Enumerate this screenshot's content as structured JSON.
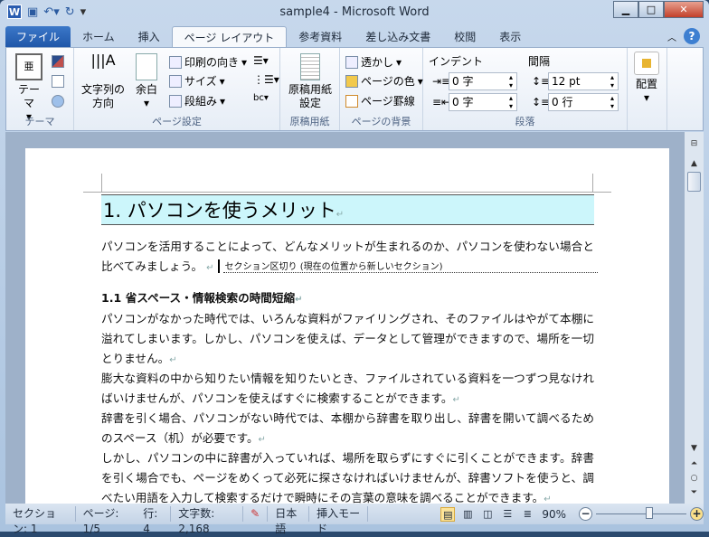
{
  "window": {
    "title": "sample4 - Microsoft Word",
    "app_icon": "W",
    "minimize": "▁",
    "maximize": "□",
    "close": "✕"
  },
  "qat": {
    "save": "save-icon",
    "undo": "undo-icon",
    "redo": "redo-icon"
  },
  "tabs": [
    {
      "label": "ファイル"
    },
    {
      "label": "ホーム"
    },
    {
      "label": "挿入"
    },
    {
      "label": "ページ レイアウト"
    },
    {
      "label": "参考資料"
    },
    {
      "label": "差し込み文書"
    },
    {
      "label": "校閲"
    },
    {
      "label": "表示"
    }
  ],
  "help": "?",
  "ribbon": {
    "theme": {
      "label": "テーマ",
      "group": "テーマ"
    },
    "page_setup": {
      "group": "ページ設定",
      "direction": "文字列の方向",
      "margins": "余白",
      "orientation": "印刷の向き",
      "size": "サイズ",
      "columns": "段組み"
    },
    "genko": {
      "group": "原稿用紙",
      "button": "原稿用紙設定"
    },
    "background": {
      "group": "ページの背景",
      "watermark": "透かし",
      "color": "ページの色",
      "borders": "ページ罫線"
    },
    "paragraph": {
      "group": "段落",
      "indent": "インデント",
      "spacing": "間隔",
      "indent_left": "0 字",
      "indent_right": "0 字",
      "space_before": "12 pt",
      "space_after": "0 行"
    },
    "arrange": {
      "label": "配置"
    }
  },
  "document": {
    "heading1": "1. パソコンを使うメリット",
    "intro": [
      "パソコンを活用することによって、どんなメリットが生まれるのか、パソコンを使わない場合と",
      "比べてみましょう。"
    ],
    "section_break": "セクション区切り (現在の位置から新しいセクション)",
    "heading2": "1.1 省スペース・情報検索の時間短縮",
    "lines": [
      "パソコンがなかった時代では、いろんな資料がファイリングされ、そのファイルはやがて本棚に",
      "溢れてしまいます。しかし、パソコンを使えば、データとして管理ができますので、場所を一切",
      "とりません。",
      "膨大な資料の中から知りたい情報を知りたいとき、ファイルされている資料を一つずつ見なけれ",
      "ばいけませんが、パソコンを使えばすぐに検索することができます。",
      "辞書を引く場合、パソコンがない時代では、本棚から辞書を取り出し、辞書を開いて調べるため",
      "のスペース（机）が必要です。",
      "しかし、パソコンの中に辞書が入っていれば、場所を取らずにすぐに引くことができます。辞書",
      "を引く場合でも、ページをめくって必死に探さなければいけませんが、辞書ソフトを使うと、調",
      "べたい用語を入力して検索するだけで瞬時にその言葉の意味を調べることができます。"
    ],
    "para_mark": "↵"
  },
  "status": {
    "section": "セクション: 1",
    "page": "ページ: 1/5",
    "line": "行: 4",
    "words": "文字数: 2,168",
    "language": "日本語",
    "mode": "挿入モード",
    "zoom": "90%",
    "zoom_percent": 90
  }
}
